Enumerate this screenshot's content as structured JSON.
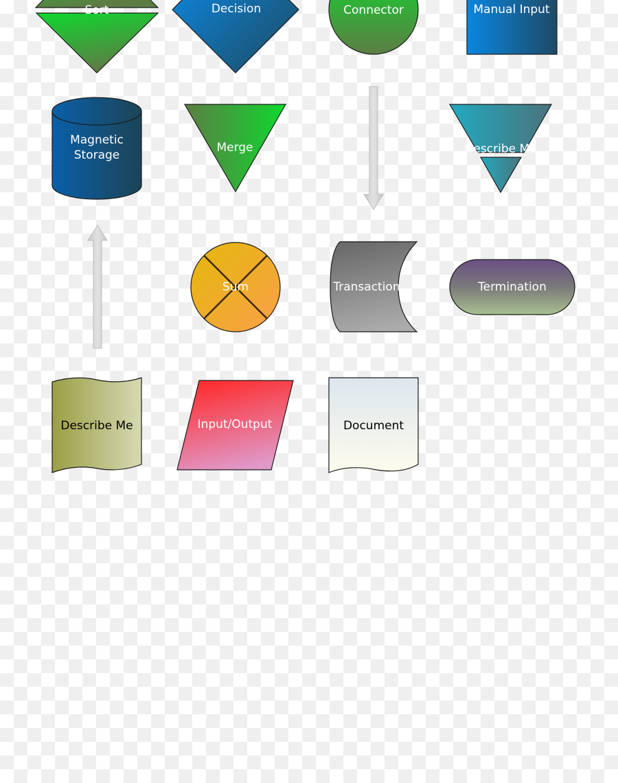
{
  "shapes": {
    "sort": {
      "label": "Sort"
    },
    "decision": {
      "label": "Decision"
    },
    "connector": {
      "label": "Connector"
    },
    "manual_input": {
      "label": "Manual Input"
    },
    "magnetic_storage": {
      "label_line1": "Magnetic",
      "label_line2": "Storage"
    },
    "merge": {
      "label": "Merge"
    },
    "extract": {
      "label": "Describe Me"
    },
    "sum": {
      "label": "Sum"
    },
    "transaction": {
      "label": "Transaction"
    },
    "termination": {
      "label": "Termination"
    },
    "card": {
      "label": "Describe Me"
    },
    "input_output": {
      "label": "Input/Output"
    },
    "document": {
      "label": "Document"
    }
  },
  "colors": {
    "green": "#0ed82e",
    "blue": "#0a86e0",
    "teal": "#26a8b8",
    "orange": "#e8b80a",
    "gray": "#6e6e6e",
    "purple": "#6a4f86",
    "olive": "#9a9f45",
    "red": "#ff2a2a"
  }
}
